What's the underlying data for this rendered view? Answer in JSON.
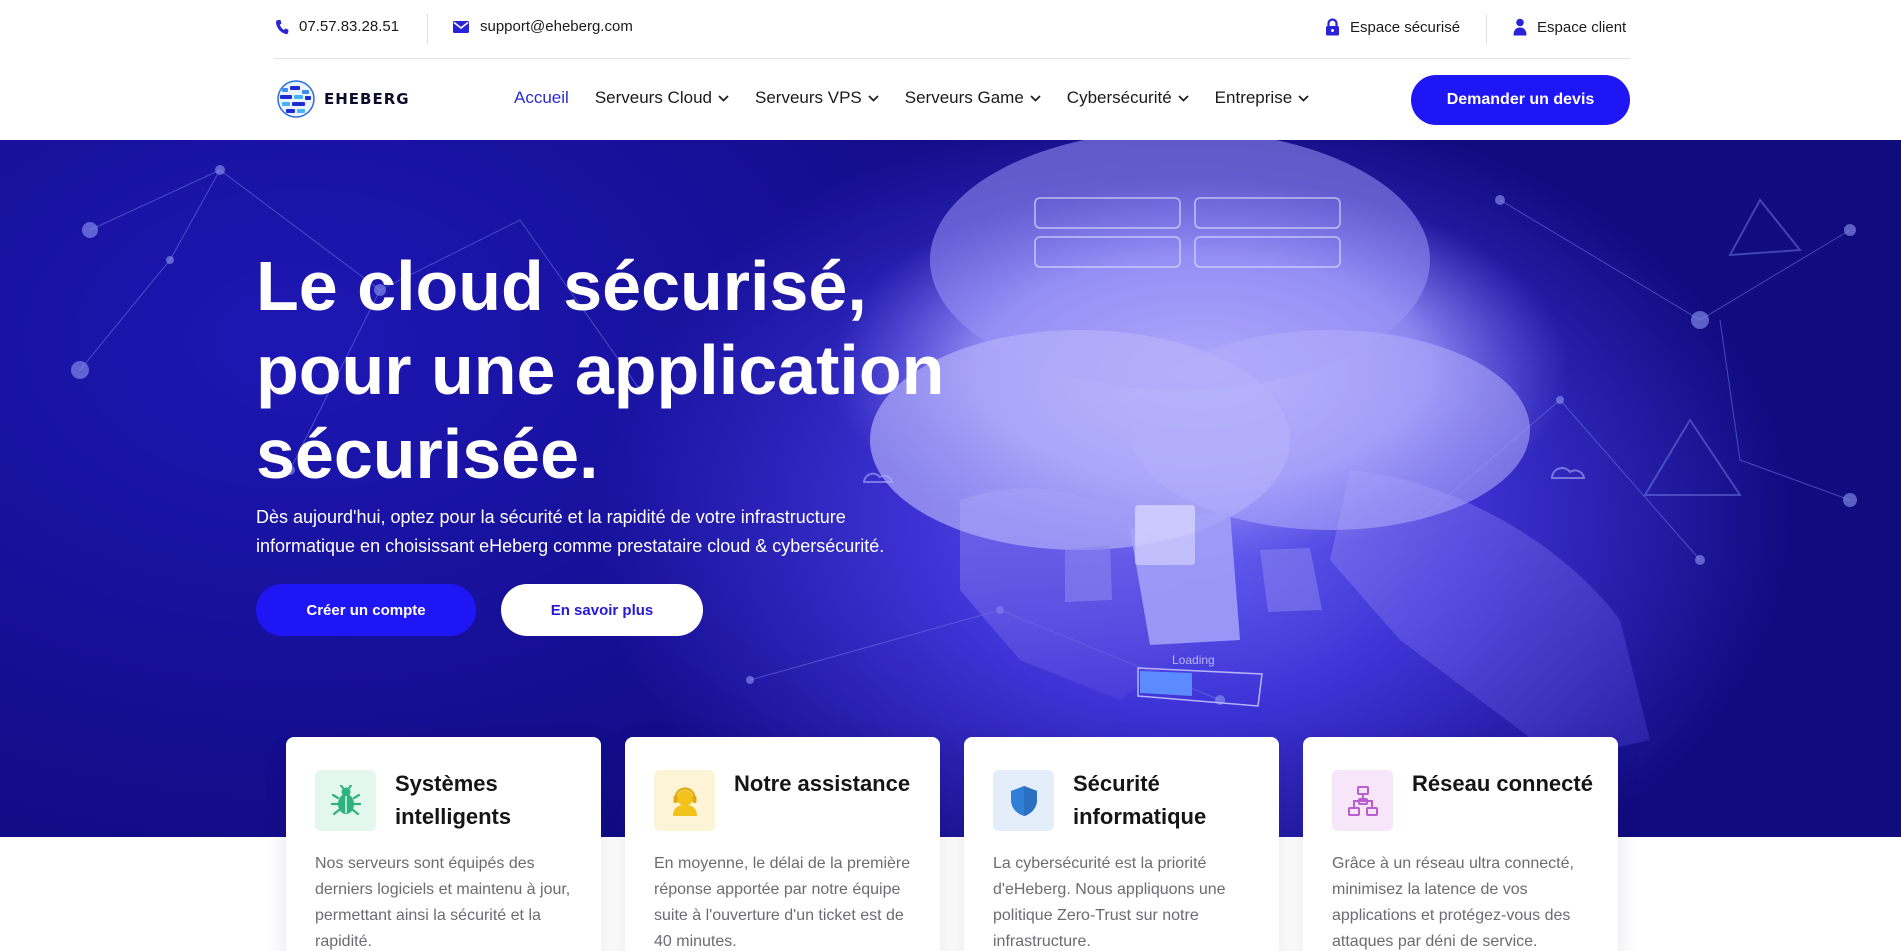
{
  "topbar": {
    "phone": "07.57.83.28.51",
    "email": "support@eheberg.com",
    "secure_area": "Espace sécurisé",
    "client_area": "Espace client"
  },
  "nav": {
    "logo_text": "EHEBERG",
    "items": [
      {
        "label": "Accueil",
        "active": true,
        "dropdown": false
      },
      {
        "label": "Serveurs Cloud",
        "active": false,
        "dropdown": true
      },
      {
        "label": "Serveurs VPS",
        "active": false,
        "dropdown": true
      },
      {
        "label": "Serveurs Game",
        "active": false,
        "dropdown": true
      },
      {
        "label": "Cybersécurité",
        "active": false,
        "dropdown": true
      },
      {
        "label": "Entreprise",
        "active": false,
        "dropdown": true
      }
    ],
    "cta_label": "Demander un devis"
  },
  "hero": {
    "title_lines": [
      "Le cloud sécurisé,",
      "pour une application",
      "sécurisée."
    ],
    "subtitle": "Dès aujourd'hui, optez pour la sécurité et la rapidité de votre infrastructure informatique en choisissant eHeberg comme prestataire cloud & cybersécurité.",
    "primary_button": "Créer un compte",
    "secondary_button": "En savoir plus",
    "loading_text": "Loading"
  },
  "features": [
    {
      "icon": "bug-icon",
      "title": "Systèmes intelligents",
      "text": "Nos serveurs sont équipés des derniers logiciels et maintenu à jour, permettant ainsi la sécurité et la rapidité.",
      "icon_bg": "#e4f7ef",
      "icon_color": "#2fb37e"
    },
    {
      "icon": "support-agent-icon",
      "title": "Notre assistance",
      "text": "En moyenne, le délai de la première réponse apportée par notre équipe suite à l'ouverture d'un ticket est de 40 minutes.",
      "icon_bg": "#fdf4d8",
      "icon_color": "#f2c21b"
    },
    {
      "icon": "shield-icon",
      "title": "Sécurité informatique",
      "text": "La cybersécurité est la priorité d'eHeberg. Nous appliquons une politique Zero-Trust sur notre infrastructure.",
      "icon_bg": "#e3eefa",
      "icon_color": "#2f7fd6"
    },
    {
      "icon": "network-icon",
      "title": "Réseau connecté",
      "text": "Grâce à un réseau ultra connecté, minimisez la latence de vos applications et protégez-vous des attaques par déni de service.",
      "icon_bg": "#f7e6fa",
      "icon_color": "#b95dcf"
    }
  ],
  "colors": {
    "brand": "#1f16f5",
    "hero_bg": "#150f94",
    "nav_active": "#2b2bd6"
  }
}
